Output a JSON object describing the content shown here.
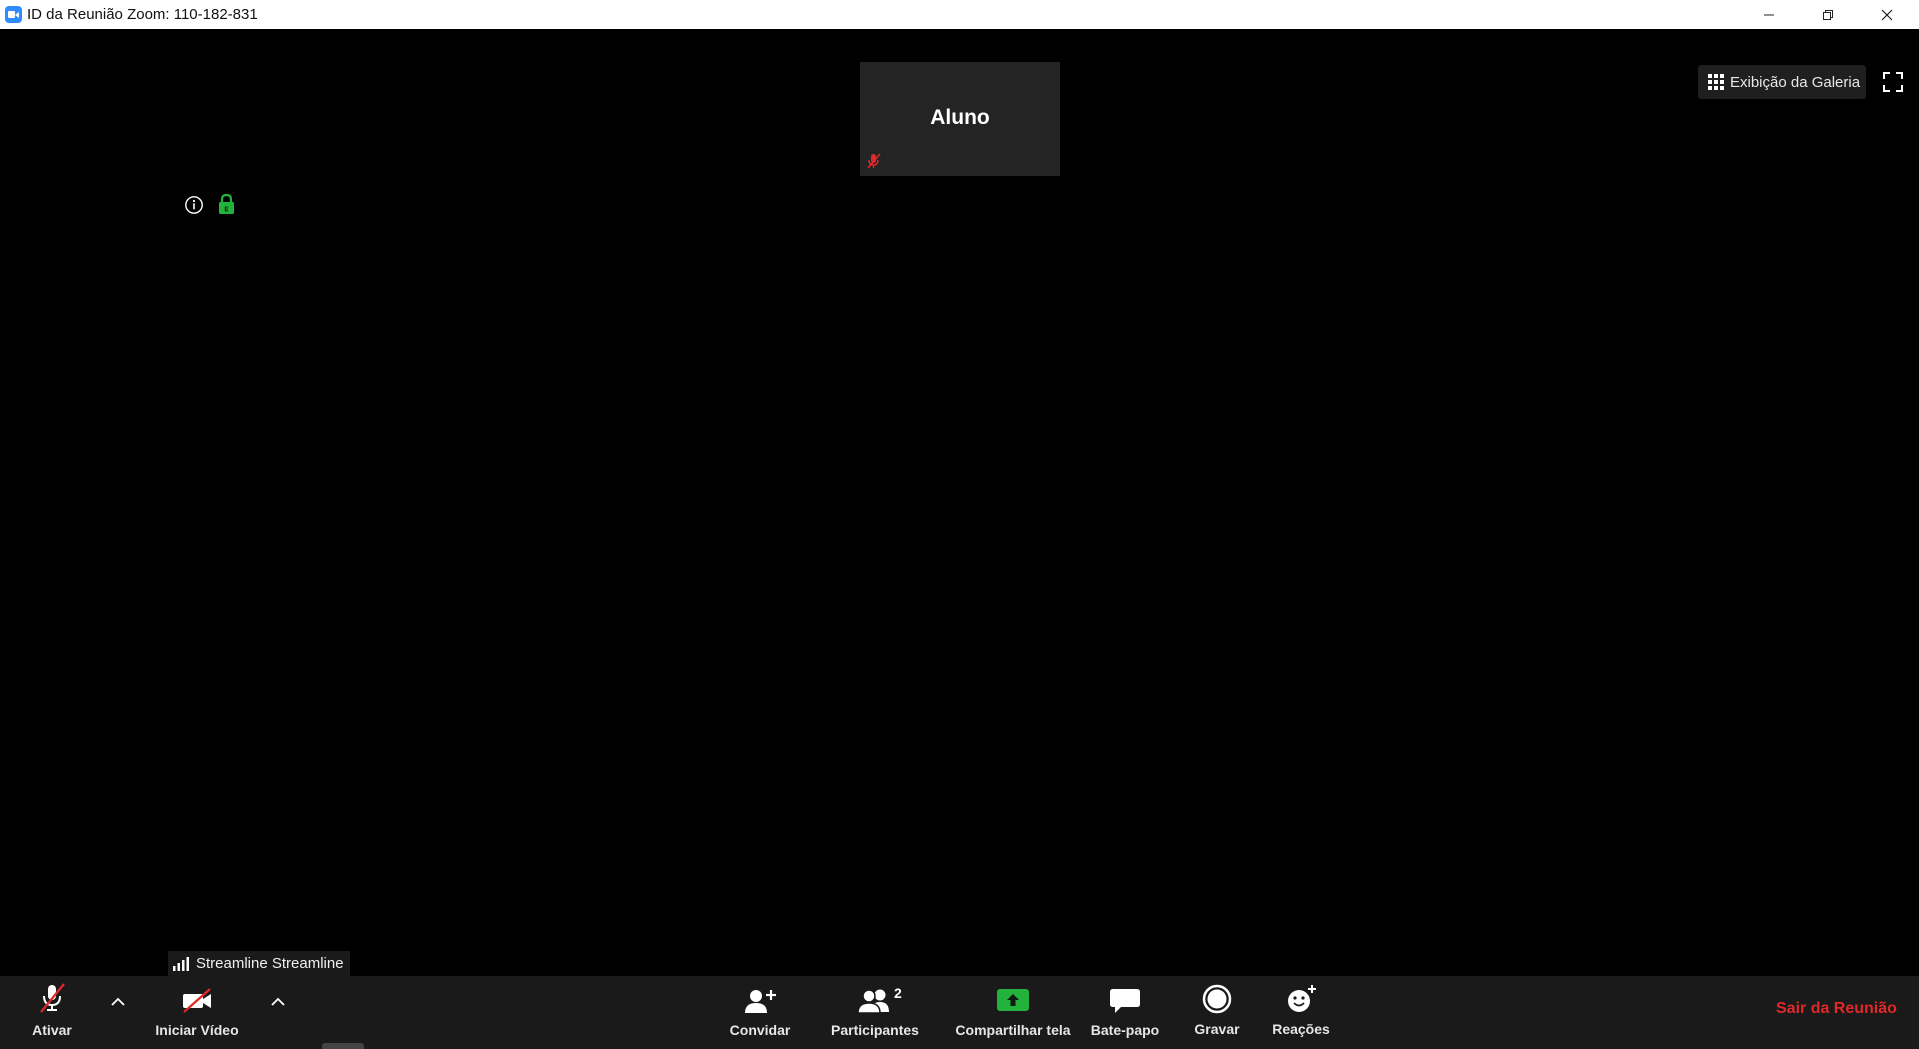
{
  "window": {
    "title": "ID da Reunião Zoom: 110-182-831",
    "app_icon": "zoom-icon",
    "controls": [
      "minimize-icon",
      "restore-icon",
      "close-icon"
    ]
  },
  "stage": {
    "thumbnail": {
      "name": "Aluno",
      "muted": true
    },
    "gallery_view_label": "Exibição da Galeria",
    "speaker_label": "Streamline Streamline",
    "icons": [
      "info-icon",
      "encryption-lock-icon",
      "gallery-grid-icon",
      "fullscreen-icon",
      "signal-bars-icon"
    ]
  },
  "toolbar": {
    "mute_label": "Ativar",
    "video_label": "Iniciar Vídeo",
    "invite_label": "Convidar",
    "participants_label": "Participantes",
    "participants_count": "2",
    "share_label": "Compartilhar tela",
    "chat_label": "Bate-papo",
    "record_label": "Gravar",
    "reactions_label": "Reações",
    "leave_label": "Sair da Reunião"
  },
  "colors": {
    "share_green": "#23b33c",
    "leave_red": "#e02828",
    "mute_red": "#e02828",
    "lock_green": "#23b33c",
    "toolbar_bg": "#1a1a1a"
  }
}
